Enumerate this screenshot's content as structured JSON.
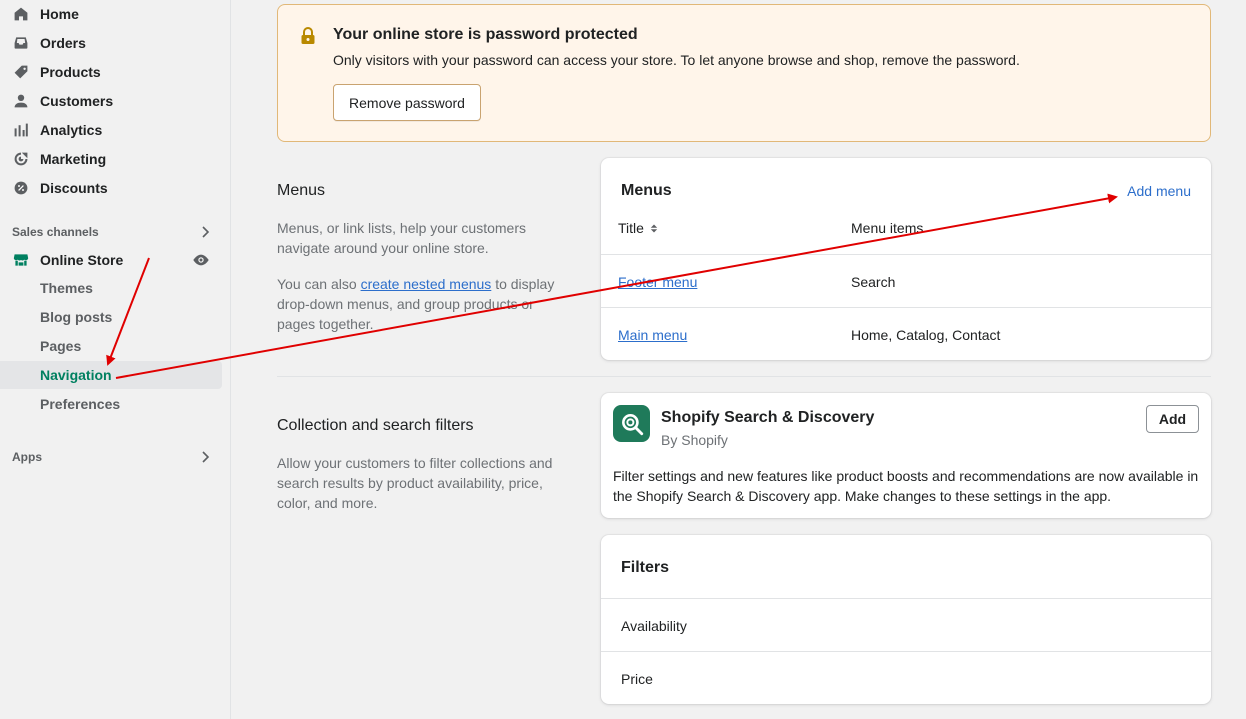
{
  "sidebar": {
    "items": [
      {
        "label": "Home",
        "icon": "home-icon"
      },
      {
        "label": "Orders",
        "icon": "inbox-icon"
      },
      {
        "label": "Products",
        "icon": "tag-icon"
      },
      {
        "label": "Customers",
        "icon": "person-icon"
      },
      {
        "label": "Analytics",
        "icon": "bar-chart-icon"
      },
      {
        "label": "Marketing",
        "icon": "target-icon"
      },
      {
        "label": "Discounts",
        "icon": "discount-icon"
      }
    ],
    "sales_channels_label": "Sales channels",
    "online_store_label": "Online Store",
    "online_store_sub": [
      "Themes",
      "Blog posts",
      "Pages",
      "Navigation",
      "Preferences"
    ],
    "active_sub": "Navigation",
    "apps_label": "Apps"
  },
  "banner": {
    "title": "Your online store is password protected",
    "description": "Only visitors with your password can access your store. To let anyone browse and shop, remove the password.",
    "button_label": "Remove password"
  },
  "menus_section": {
    "title": "Menus",
    "desc1": "Menus, or link lists, help your customers navigate around your online store.",
    "desc2_prefix": "You can also ",
    "desc2_link": "create nested menus",
    "desc2_suffix": " to display drop-down menus, and group products or pages together."
  },
  "menus_card": {
    "title": "Menus",
    "add_label": "Add menu",
    "col_title": "Title",
    "col_items": "Menu items",
    "rows": [
      {
        "title": "Footer menu",
        "items": "Search"
      },
      {
        "title": "Main menu",
        "items": "Home, Catalog, Contact"
      }
    ]
  },
  "filters_section": {
    "title": "Collection and search filters",
    "desc": "Allow your customers to filter collections and search results by product availability, price, color, and more."
  },
  "app_card": {
    "name": "Shopify Search & Discovery",
    "by": "By Shopify",
    "add_label": "Add",
    "description": "Filter settings and new features like product boosts and recommendations are now available in the Shopify Search & Discovery app. Make changes to these settings in the app."
  },
  "filters_card": {
    "title": "Filters",
    "rows": [
      "Availability",
      "Price"
    ]
  },
  "colors": {
    "accent_green": "#008060",
    "link_blue": "#2c6ecb",
    "banner_bg": "#fff5ea",
    "annotation_red": "#e00000"
  }
}
